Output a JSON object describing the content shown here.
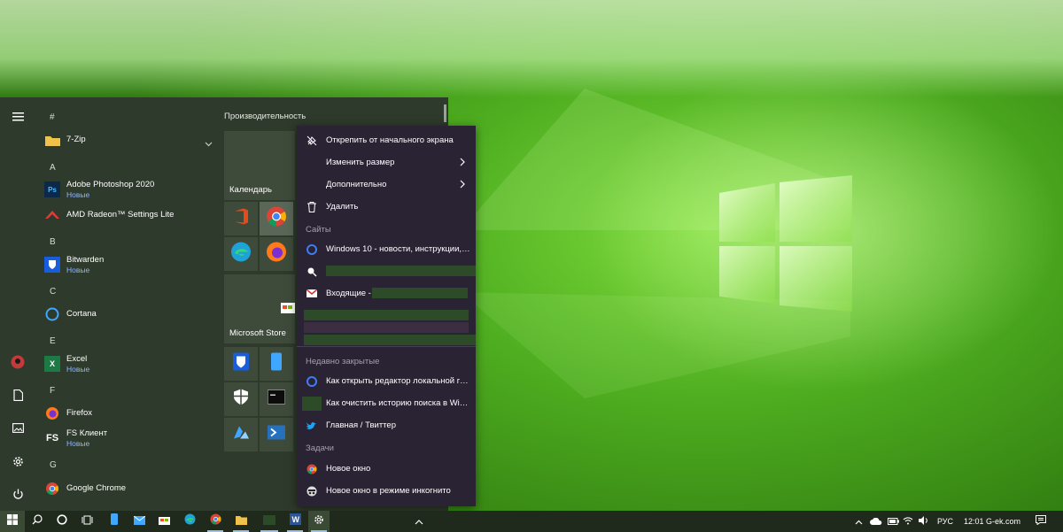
{
  "start_menu": {
    "group_title": "Производительность",
    "letters": [
      "#",
      "A",
      "B",
      "C",
      "E",
      "F",
      "G"
    ],
    "apps": [
      {
        "name": "7-Zip",
        "sub": "",
        "icon": "folder-icon"
      },
      {
        "name": "Adobe Photoshop 2020",
        "sub": "Новые",
        "icon": "photoshop-icon"
      },
      {
        "name": "AMD Radeon™ Settings Lite",
        "sub": "",
        "icon": "amd-icon"
      },
      {
        "name": "Bitwarden",
        "sub": "Новые",
        "icon": "bitwarden-icon"
      },
      {
        "name": "Cortana",
        "sub": "",
        "icon": "cortana-icon"
      },
      {
        "name": "Excel",
        "sub": "Новые",
        "icon": "excel-icon"
      },
      {
        "name": "Firefox",
        "sub": "",
        "icon": "firefox-icon"
      },
      {
        "name": "FS Клиент",
        "sub": "Новые",
        "icon": "fs-icon"
      },
      {
        "name": "Google Chrome",
        "sub": "",
        "icon": "chrome-icon"
      }
    ],
    "fs_icon_text": "FS",
    "ps_icon_text": "Ps",
    "tiles": {
      "calendar_label": "Календарь",
      "store_label": "Microsoft Store"
    }
  },
  "context_menu": {
    "items": [
      {
        "label": "Открепить от начального экрана",
        "icon": "unpin-icon"
      },
      {
        "label": "Изменить размер",
        "icon": "",
        "submenu": true
      },
      {
        "label": "Дополнительно",
        "icon": "",
        "submenu": true
      },
      {
        "label": "Удалить",
        "icon": "trash-icon"
      }
    ],
    "sites_header": "Сайты",
    "sites": [
      {
        "label": "Windows 10 - новости, инструкции, ...",
        "icon": "site-icon"
      },
      {
        "label": "",
        "icon": "search-site-icon"
      },
      {
        "label": "Входящие -",
        "icon": "gmail-icon"
      }
    ],
    "recent_header": "Недавно закрытые",
    "recent": [
      {
        "label": "Как открыть редактор локальной гру...",
        "icon": "site-icon"
      },
      {
        "label": "Как очистить историю поиска в Win...",
        "icon": "thumb-icon"
      },
      {
        "label": "Главная / Твиттер",
        "icon": "twitter-icon"
      }
    ],
    "tasks_header": "Задачи",
    "tasks": [
      {
        "label": "Новое окно",
        "icon": "chrome-icon"
      },
      {
        "label": "Новое окно в режиме инкогнито",
        "icon": "incognito-icon"
      }
    ]
  },
  "taskbar": {
    "language": "РУС",
    "time": "12:01",
    "watermark": "G-ek.com"
  },
  "colors": {
    "start_bg": "#2e3a2b",
    "context_bg": "#2a2334",
    "taskbar_bg": "#1f2a1c",
    "accent_new": "#8fb7ff"
  }
}
